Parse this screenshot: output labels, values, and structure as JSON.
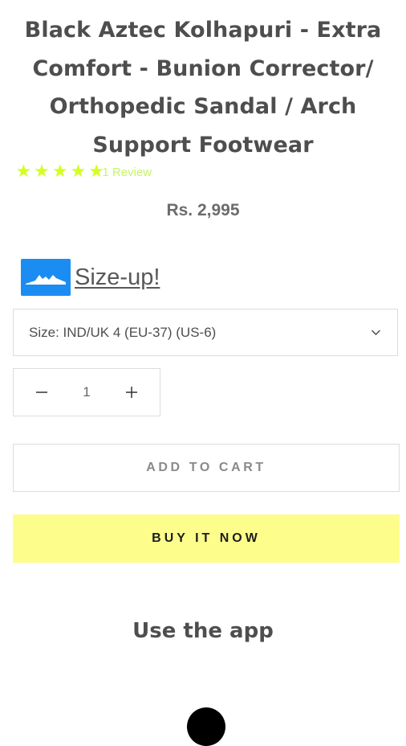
{
  "product": {
    "title": "Black Aztec Kolhapuri - Extra Comfort - Bunion Corrector/ Orthopedic Sandal / Arch Support Footwear",
    "rating": 5,
    "review_text": "1 Review",
    "price": "Rs. 2,995"
  },
  "sizeup": {
    "label": "Size-up!",
    "icon": "sizeup-logo-icon"
  },
  "size_select": {
    "value": "Size: IND/UK 4 (EU-37) (US-6)"
  },
  "quantity": {
    "value": "1"
  },
  "buttons": {
    "add_to_cart": "ADD TO CART",
    "buy_now": "BUY IT NOW"
  },
  "app_section": {
    "heading": "Use the app"
  },
  "colors": {
    "star": "#d4ff1f",
    "review_link": "#c7f56a",
    "buy_now_bg": "#fdfd8b",
    "sizeup_logo_bg": "#1b8df2"
  }
}
